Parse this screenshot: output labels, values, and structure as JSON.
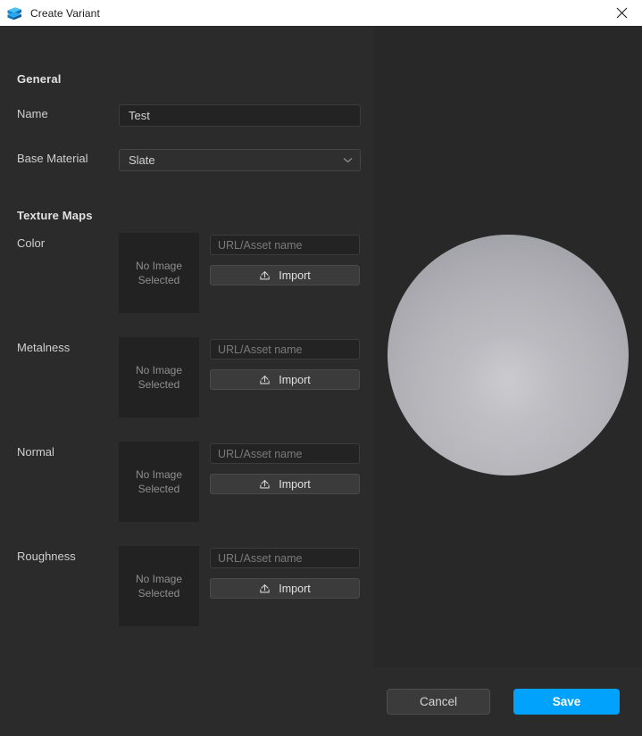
{
  "window": {
    "title": "Create Variant",
    "icon": "app-logo-icon",
    "close_label": "×"
  },
  "general": {
    "section_title": "General",
    "name": {
      "label": "Name",
      "value": "Test",
      "placeholder": ""
    },
    "base_material": {
      "label": "Base Material",
      "value": "Slate"
    }
  },
  "texture_maps": {
    "section_title": "Texture Maps",
    "thumb_placeholder": "No Image\nSelected",
    "thumb_line1": "No Image",
    "thumb_line2": "Selected",
    "url_placeholder": "URL/Asset name",
    "import_label": "Import",
    "rows": [
      {
        "label": "Color",
        "url_value": "",
        "url_placeholder": "URL/Asset name",
        "import_label": "Import",
        "thumb_line1": "No Image",
        "thumb_line2": "Selected"
      },
      {
        "label": "Metalness",
        "url_value": "",
        "url_placeholder": "URL/Asset name",
        "import_label": "Import",
        "thumb_line1": "No Image",
        "thumb_line2": "Selected"
      },
      {
        "label": "Normal",
        "url_value": "",
        "url_placeholder": "URL/Asset name",
        "import_label": "Import",
        "thumb_line1": "No Image",
        "thumb_line2": "Selected"
      },
      {
        "label": "Roughness",
        "url_value": "",
        "url_placeholder": "URL/Asset name",
        "import_label": "Import",
        "thumb_line1": "No Image",
        "thumb_line2": "Selected"
      }
    ]
  },
  "preview": {
    "shape": "sphere",
    "material_color": "#b8b8bd"
  },
  "footer": {
    "cancel_label": "Cancel",
    "save_label": "Save"
  },
  "colors": {
    "titlebar_bg": "#ffffff",
    "panel_bg": "#2b2b2b",
    "viewport_bg": "#282828",
    "input_bg": "#232323",
    "button_bg": "#3b3b3b",
    "accent": "#00a2fb"
  }
}
